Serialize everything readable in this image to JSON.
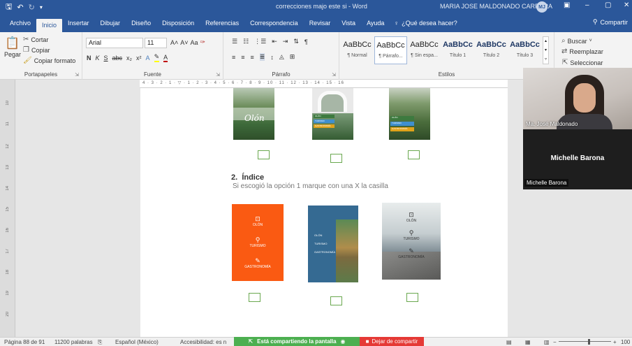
{
  "window": {
    "title": "correcciones majo este si - Word",
    "user_name": "MARIA JOSE MALDONADO CARRERA",
    "user_initials": "MJ"
  },
  "tabs": [
    "Archivo",
    "Inicio",
    "Insertar",
    "Dibujar",
    "Diseño",
    "Disposición",
    "Referencias",
    "Correspondencia",
    "Revisar",
    "Vista",
    "Ayuda"
  ],
  "tell_me": "¿Qué desea hacer?",
  "share_label": "Compartir",
  "ribbon": {
    "clipboard": {
      "label": "Portapapeles",
      "cut": "Cortar",
      "copy": "Copiar",
      "paste": "Pegar",
      "format_painter": "Copiar formato"
    },
    "font": {
      "label": "Fuente",
      "name": "Arial",
      "size": "11",
      "aa": "Aa"
    },
    "paragraph": {
      "label": "Párrafo"
    },
    "styles": {
      "label": "Estilos",
      "items": [
        {
          "sample": "AaBbCc",
          "name": "¶ Normal"
        },
        {
          "sample": "AaBbCc",
          "name": "¶ Párrafo..."
        },
        {
          "sample": "AaBbCc",
          "name": "¶ Sin espa..."
        },
        {
          "sample": "AaBbCc",
          "name": "Título 1"
        },
        {
          "sample": "AaBbCc",
          "name": "Título 2"
        },
        {
          "sample": "AaBbCc",
          "name": "Título 3"
        }
      ]
    },
    "editing": {
      "search": "Buscar",
      "replace": "Reemplazar",
      "select": "Seleccionar"
    }
  },
  "document": {
    "section_number": "2.",
    "section_title": "Índice",
    "section_subtitle": "Si escogió la opción 1 marque con una X la casilla",
    "brand_text": "Olón",
    "menu_items": [
      "OLÓN",
      "TURISMO",
      "GASTRONOMÍA"
    ]
  },
  "video": {
    "self_name": "Ma. José Maldonado",
    "other_name": "Michelle Barona",
    "other_label": "Michelle Barona"
  },
  "status": {
    "page": "Página 88 de 91",
    "words": "11200 palabras",
    "language": "Español (México)",
    "accessibility": "Accesibilidad: es n",
    "sharing": "Está compartiendo la pantalla",
    "stop_sharing": "Dejar de compartir",
    "zoom": "100"
  },
  "colors": {
    "word_blue": "#2b579a",
    "orange": "#fa5a12",
    "steel_blue": "#356a92",
    "green_share": "#4caf50",
    "red_stop": "#e53935"
  }
}
